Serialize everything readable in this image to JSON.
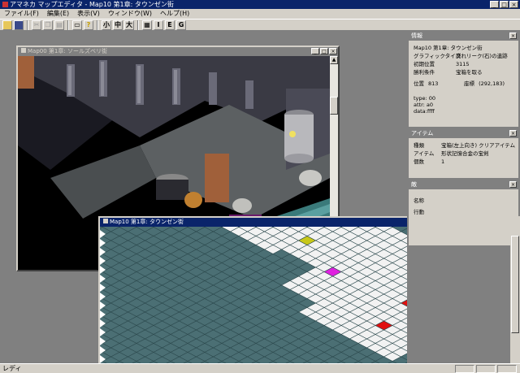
{
  "app": {
    "title": "アマネカ マップエディタ - Map10 第1章: タウンゼン街"
  },
  "menu": [
    "ファイル(F)",
    "編集(E)",
    "表示(V)",
    "ウィンドウ(W)",
    "ヘルプ(H)"
  ],
  "toolbar": {
    "small": "小",
    "medium": "中",
    "large": "大",
    "i": "I",
    "e": "E",
    "g": "G"
  },
  "win_scene": {
    "title": "Map00 第1章: ソールズベリ街"
  },
  "win_grid": {
    "title": "Map10 第1章: タウンゼン街"
  },
  "info": {
    "title": "情報",
    "map": "Map10 第1章: タウンゼン街",
    "rows": [
      {
        "k": "グラフィックタイプ",
        "v": "廃れリーク(石)の遺跡"
      },
      {
        "k": "初期位置",
        "v": "3115"
      },
      {
        "k": "勝利条件",
        "v": "宝箱を取る"
      }
    ],
    "pos_label": "位置",
    "pos_value": "813",
    "coord_label": "座標",
    "coord_value": "(292,183)",
    "type": "type: 00",
    "attr": "attr: a0",
    "data": "data:ffff"
  },
  "item": {
    "title": "アイテム",
    "rows": [
      {
        "k": "種類",
        "v": "宝箱(左上向き) クリアアイテム"
      },
      {
        "k": "アイテム",
        "v": "形状記憶合金の宝剣"
      },
      {
        "k": "個数",
        "v": "1"
      }
    ]
  },
  "enemy": {
    "title": "敵",
    "name_label": "名称",
    "action_label": "行動"
  },
  "status": {
    "text": "レディ"
  },
  "colors": {
    "grid_bg": "#4b6f74",
    "grid_line": "#2d4a4e",
    "tile_white": "#f2f2f2",
    "marker_red": "#e01010",
    "marker_yellow": "#c8c818",
    "marker_magenta": "#e020e0",
    "marker_black": "#000000"
  }
}
